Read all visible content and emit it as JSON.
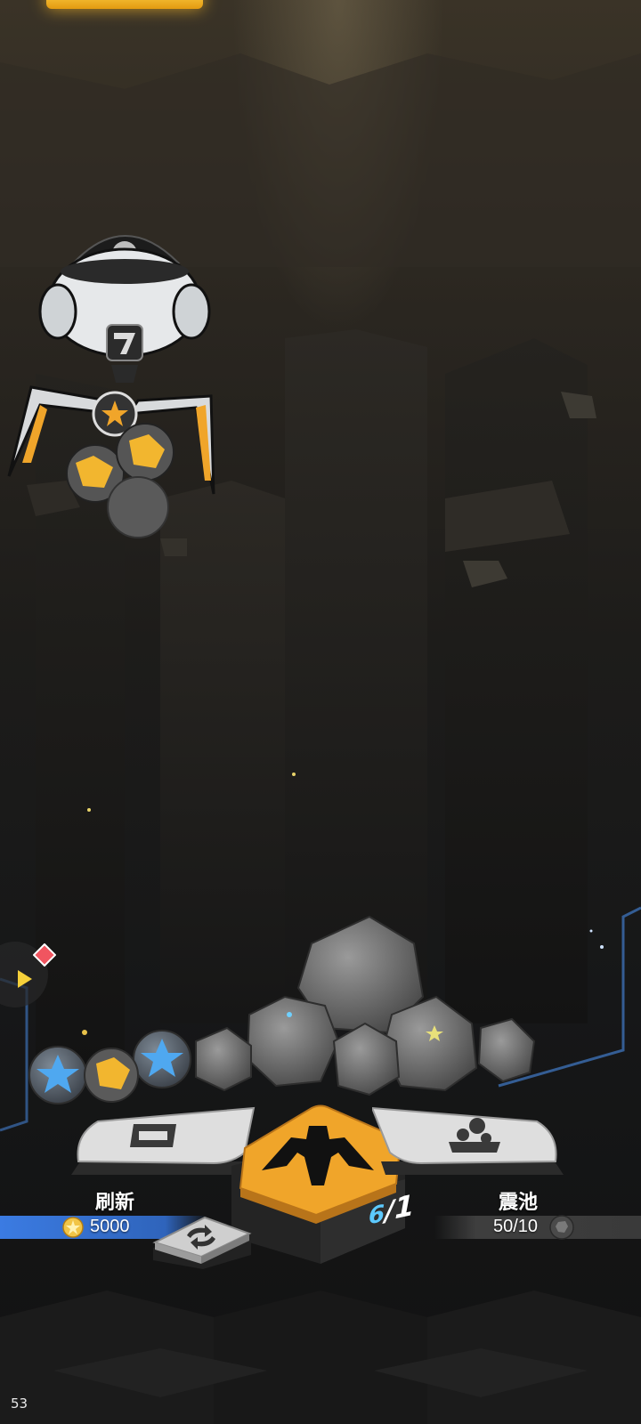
{
  "hud": {
    "fps_value": "53"
  },
  "refresh": {
    "label": "刷新",
    "cost": "5000",
    "icon": "refresh-card-icon",
    "currency_icon": "gold-star-coin-icon",
    "bar_color": "#3a7ae0"
  },
  "shake_pool": {
    "label": "震池",
    "progress_text": "50/10",
    "icon": "shake-pool-icon",
    "orb_icon": "rock-orb-icon"
  },
  "claw_button": {
    "icon": "claw-icon",
    "count_current": "6",
    "count_separator": "/",
    "count_total": "1",
    "color": "#f0a52a"
  },
  "recycle_button": {
    "icon": "recycle-arrows-icon"
  },
  "side_indicator": {
    "icon": "play-arrow-icon",
    "alert_icon": "red-diamond-icon"
  },
  "claw_machine": {
    "icon": "claw-machine-icon",
    "number_icon": "number-7-icon"
  },
  "colors": {
    "accent_gold": "#f0a52a",
    "accent_blue": "#3a7ae0",
    "panel_grey": "#d9d9d9"
  }
}
